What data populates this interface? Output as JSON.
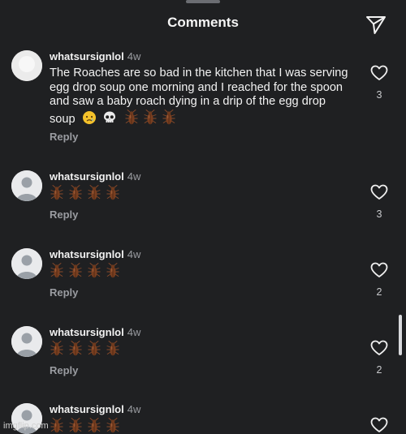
{
  "header": {
    "title": "Comments",
    "send_icon": "send-icon"
  },
  "comments": [
    {
      "username": "whatsursignlol",
      "time": "4w",
      "text": "The Roaches are so bad in the kitchen that I was serving egg drop soup one morning and I reached for the spoon and saw a baby roach dying in a drip of the egg drop soup",
      "trailing_emojis": [
        "crying-face",
        "skull",
        "cockroach",
        "cockroach",
        "cockroach"
      ],
      "reply_label": "Reply",
      "likes": "3"
    },
    {
      "username": "whatsursignlol",
      "time": "4w",
      "emojis": [
        "cockroach",
        "cockroach",
        "cockroach",
        "cockroach"
      ],
      "reply_label": "Reply",
      "likes": "3"
    },
    {
      "username": "whatsursignlol",
      "time": "4w",
      "emojis": [
        "cockroach",
        "cockroach",
        "cockroach",
        "cockroach"
      ],
      "reply_label": "Reply",
      "likes": "2"
    },
    {
      "username": "whatsursignlol",
      "time": "4w",
      "emojis": [
        "cockroach",
        "cockroach",
        "cockroach",
        "cockroach"
      ],
      "reply_label": "Reply",
      "likes": "2"
    },
    {
      "username": "whatsursignlol",
      "time": "4w",
      "emojis": [
        "cockroach",
        "cockroach",
        "cockroach",
        "cockroach"
      ],
      "reply_label": "",
      "likes": ""
    }
  ],
  "watermark": "imgflip.com"
}
